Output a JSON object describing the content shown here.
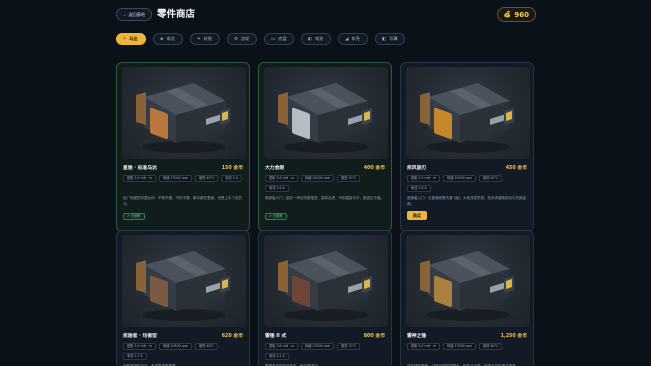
{
  "header": {
    "back_label": "← 返回基地",
    "title": "零件商店",
    "coin_icon": "coin-bag-icon",
    "coins": "960"
  },
  "filters": [
    {
      "icon": "⚡",
      "label": "马达",
      "active": true
    },
    {
      "icon": "◈",
      "label": "电池",
      "active": false
    },
    {
      "icon": "✦",
      "label": "轮胎",
      "active": false
    },
    {
      "icon": "⚙",
      "label": "齿轮",
      "active": false
    },
    {
      "icon": "▭",
      "label": "底盘",
      "active": false
    },
    {
      "icon": "◐",
      "label": "电池",
      "active": false
    },
    {
      "icon": "◢",
      "label": "车壳",
      "active": false
    },
    {
      "icon": "◧",
      "label": "导翼",
      "active": false
    }
  ],
  "products": [
    {
      "name": "星驰 · 标准马达",
      "price": "150 金币",
      "specs": [
        "扭矩 3.0 mN · m",
        "转速 17000 rpm",
        "散热 45°C",
        "电流 2 A"
      ],
      "desc": "出厂标配的可靠伙伴：不快不慢、不热不燥，新手都在里面。也是上手了走的马。",
      "status": "已拥有",
      "owned": true,
      "plate_color": "#b9773b"
    },
    {
      "name": "大力金刚",
      "price": "400 金币",
      "specs": [
        "扭矩 3.6 mN · m",
        "转速 15000 rpm",
        "散热 50°C",
        "电流 2.6 A"
      ],
      "desc": "爬坡高人门：起步一声巨吼般推进，急转必虎，可别直接平平，都进过平面。",
      "status": "已拥有",
      "owned": true,
      "plate_color": "#b4bcc4"
    },
    {
      "name": "疾风旋刃",
      "price": "450 金币",
      "specs": [
        "扭矩 2.5 mN · m",
        "转速 24000 rpm",
        "散热 62°C",
        "电流 3.6 A"
      ],
      "desc": "追速者入门：长直道就是天竟飞起；大电流发热快，技术流道跑前后平抗类高频。",
      "status": "购买",
      "owned": false,
      "plate_color": "#c8862a"
    },
    {
      "name": "疾驰者 · 均衡型",
      "price": "620 金币",
      "specs": [
        "扭矩 3.0 mN · m",
        "转速 20500 rpm",
        "散热 48°C",
        "电流 2.7 A"
      ],
      "desc": "均衡型进阶马达，各项表现都稳健。",
      "status": "",
      "owned": false,
      "plate_color": "#7a5a40"
    },
    {
      "name": "雷锤 II 式",
      "price": "800 金币",
      "specs": [
        "扭矩 3.8 mN · m",
        "转速 27000 rpm",
        "散热 70°C",
        "电流 4.2 A"
      ],
      "desc": "雷锤系列的升级版本，输出更强劲。",
      "status": "",
      "owned": false,
      "plate_color": "#6e4638"
    },
    {
      "name": "雷神之锤",
      "price": "1,250 金币",
      "specs": [
        "扭矩 5.0 mN · m",
        "转速 17500 rpm",
        "散热 60°C"
      ],
      "desc": "顶级扭矩怪兽：过弯加速如同雷击，耐热又出稳；转速天花板更高更强。",
      "status": "",
      "owned": false,
      "plate_color": "#a9803e"
    }
  ]
}
